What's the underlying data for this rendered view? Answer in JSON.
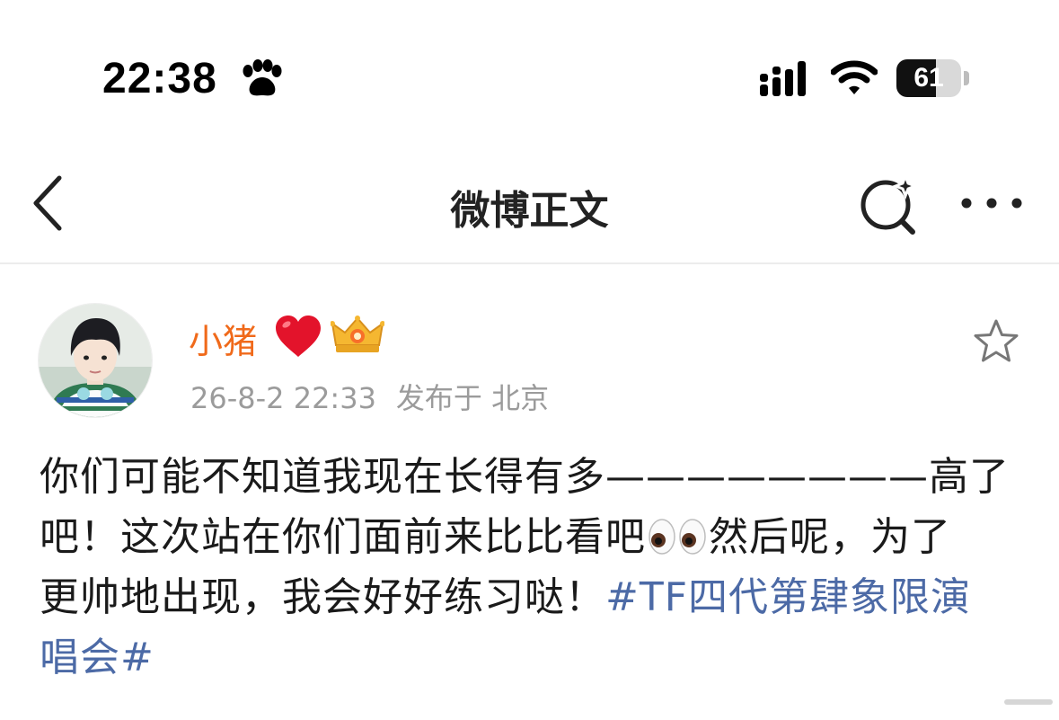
{
  "status_bar": {
    "time": "22:38",
    "battery_level": "61",
    "battery_fraction": 0.61,
    "icons": [
      "paw-icon",
      "signal-icon",
      "wifi-icon",
      "battery-icon"
    ]
  },
  "nav": {
    "title": "微博正文",
    "icons": [
      "back-chevron-icon",
      "search-sparkle-icon",
      "more-dots-icon"
    ]
  },
  "post": {
    "author": "小猪",
    "author_emoji": "❤️",
    "badge": "crown-icon",
    "date": "26-8-2 22:33",
    "location": "发布于 北京",
    "text_lines": [
      "你们可能不知道我现在长得有多————————高了",
      "吧！这次站在你们面前来比比看吧",
      "然后呢，为了",
      "更帅地出现，我会好好练习哒！",
      "#TF四代第肆象限演",
      "唱会#"
    ],
    "inline_emoji": "eyes-icon",
    "colors": {
      "username": "#f06a1b",
      "hashtag": "#4c6aa6",
      "meta": "#9b9b9b"
    }
  }
}
